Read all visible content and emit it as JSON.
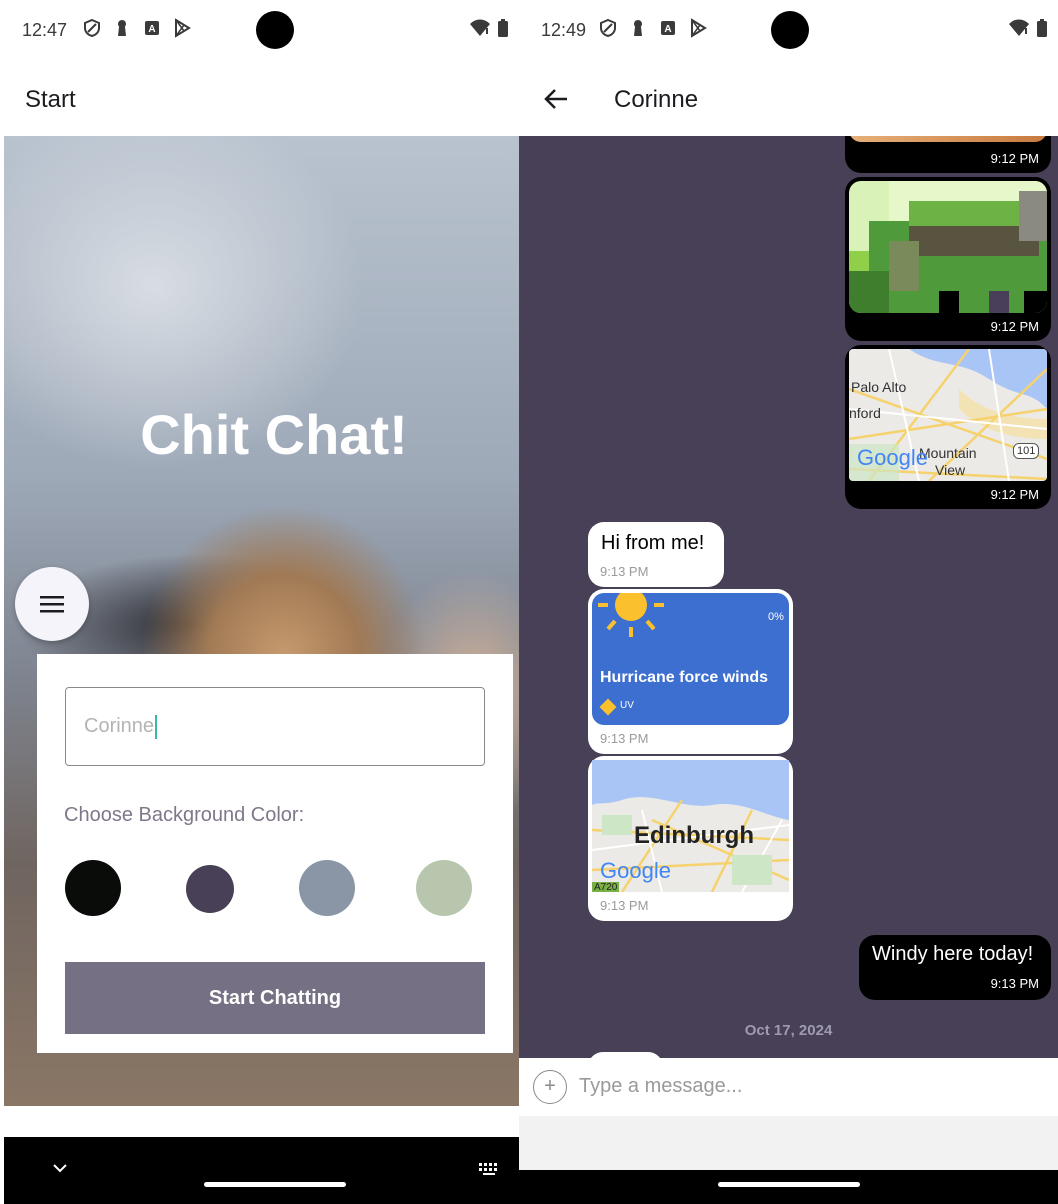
{
  "left": {
    "status": {
      "time": "12:47"
    },
    "appbar": {
      "title": "Start"
    },
    "hero": {
      "title": "Chit Chat!"
    },
    "form": {
      "name_value": "Corinne",
      "color_label": "Choose Background Color:",
      "colors": [
        "#090C08",
        "#474056",
        "#8A95A5",
        "#B9C6AE"
      ],
      "start_button": "Start Chatting"
    }
  },
  "right": {
    "status": {
      "time": "12:49"
    },
    "appbar": {
      "title": "Corinne"
    },
    "messages": {
      "m1_time": "9:12 PM",
      "m2_time": "9:12 PM",
      "m3_time": "9:12 PM",
      "m3_map_labels": {
        "a": "Palo Alto",
        "b": "nford",
        "c": "Mountain",
        "d": "View",
        "e": "101",
        "logo": "Google"
      },
      "m4_text": "Hi from me!",
      "m4_time": "9:13 PM",
      "m5_weather_title": "Hurricane force winds",
      "m5_pct": "0%",
      "m5_uv": "UV",
      "m5_time": "9:13 PM",
      "m6_map_city": "Edinburgh",
      "m6_map_logo": "Google",
      "m6_map_road": "A720",
      "m6_time": "9:13 PM",
      "m7_text": "Windy here today!",
      "m7_time": "9:13 PM"
    },
    "date_separator": "Oct 17, 2024",
    "composer": {
      "placeholder": "Type a message..."
    }
  },
  "colors": {
    "chat_bg": "#474056",
    "button": "#757083",
    "outgoing": "#000000",
    "incoming": "#FFFFFF"
  }
}
